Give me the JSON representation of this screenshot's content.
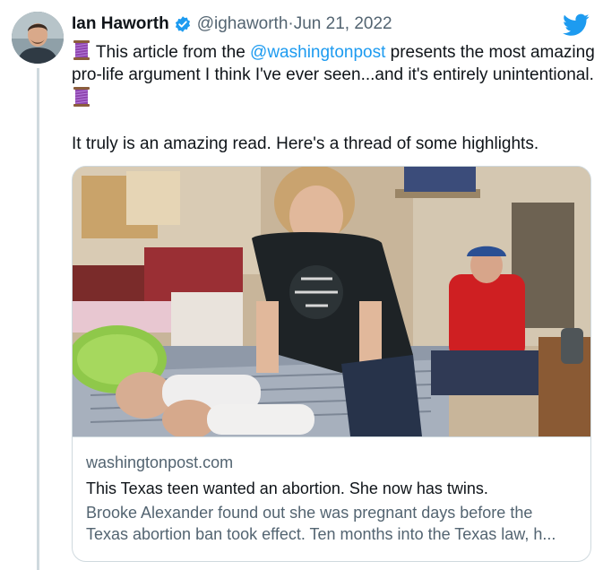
{
  "tweet": {
    "author_name": "Ian Haworth",
    "handle": "@ighaworth",
    "separator": " · ",
    "date": "Jun 21, 2022",
    "text_1_before": " This article from the ",
    "mention": "@washingtonpost",
    "text_1_after": " presents the most amazing pro-life argument I think I've ever seen...and it's entirely unintentional.",
    "text_2": "It truly is an amazing read. Here's a thread of some highlights."
  },
  "icons": {
    "verified": "verified-badge-icon",
    "brand": "twitter-bird-icon",
    "emoji": "thread-spool-emoji"
  },
  "card": {
    "domain": "washingtonpost.com",
    "title": "This Texas teen wanted an abortion. She now has twins.",
    "description_line1": "Brooke Alexander found out she was pregnant days before the",
    "description_line2": "Texas abortion ban took effect. Ten months into the Texas law, h..."
  },
  "colors": {
    "accent": "#1d9bf0",
    "secondary_text": "#536471",
    "border": "#cfd9de"
  }
}
